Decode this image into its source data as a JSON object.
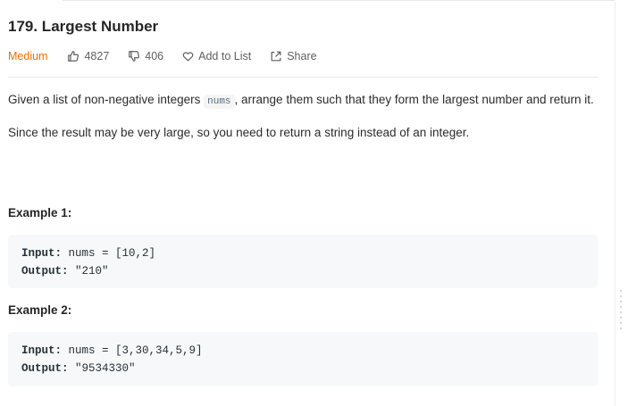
{
  "problem": {
    "title": "179. Largest Number",
    "difficulty": "Medium",
    "likes": "4827",
    "dislikes": "406",
    "add_to_list": "Add to List",
    "share": "Share"
  },
  "description": {
    "p1_before": "Given a list of non-negative integers ",
    "p1_code": "nums",
    "p1_after": ", arrange them such that they form the largest number and return it.",
    "p2": "Since the result may be very large, so you need to return a string instead of an integer."
  },
  "examples": [
    {
      "title": "Example 1:",
      "input_label": "Input:",
      "input_value": " nums = [10,2]",
      "output_label": "Output:",
      "output_value": " \"210\""
    },
    {
      "title": "Example 2:",
      "input_label": "Input:",
      "input_value": " nums = [3,30,34,5,9]",
      "output_label": "Output:",
      "output_value": " \"9534330\""
    }
  ],
  "colors": {
    "difficulty_medium": "#ef6c00",
    "code_bg": "#f7f8fa"
  },
  "icons": [
    "thumbs-up-icon",
    "thumbs-down-icon",
    "heart-icon",
    "share-icon"
  ]
}
